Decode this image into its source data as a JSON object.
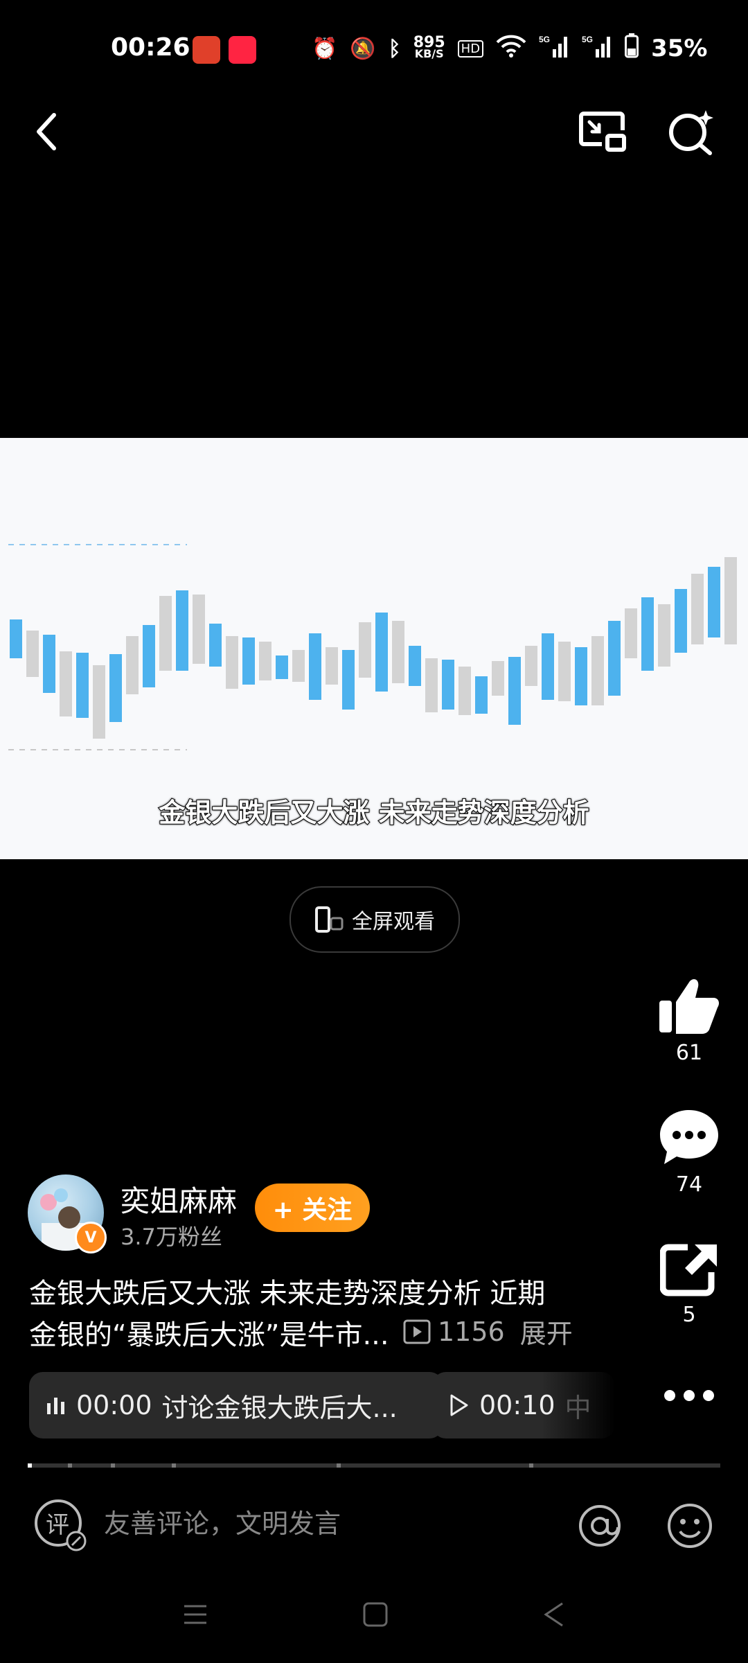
{
  "status": {
    "time": "00:26",
    "net_speed_value": "895",
    "net_speed_unit": "KB/S",
    "battery": "35%"
  },
  "video": {
    "subtitle": "金银大跌后又大涨 未来走势深度分析"
  },
  "fullscreen": {
    "label": "全屏观看"
  },
  "actions": {
    "like_count": "61",
    "comment_count": "74",
    "share_count": "5"
  },
  "author": {
    "name": "奕姐麻麻",
    "fans": "3.7万粉丝",
    "follow_label": "+ 关注"
  },
  "description": {
    "line1": "金银大跌后又大涨 未来走势深度分析 近期",
    "line2": "金银的“暴跌后大涨”是牛市...",
    "play_count": "1156",
    "expand": "展开"
  },
  "chapters": [
    {
      "time": "00:00",
      "title": "讨论金银大跌后大..."
    },
    {
      "time": "00:10",
      "title": "中"
    }
  ],
  "comment_bar": {
    "placeholder": "友善评论，文明发言"
  }
}
